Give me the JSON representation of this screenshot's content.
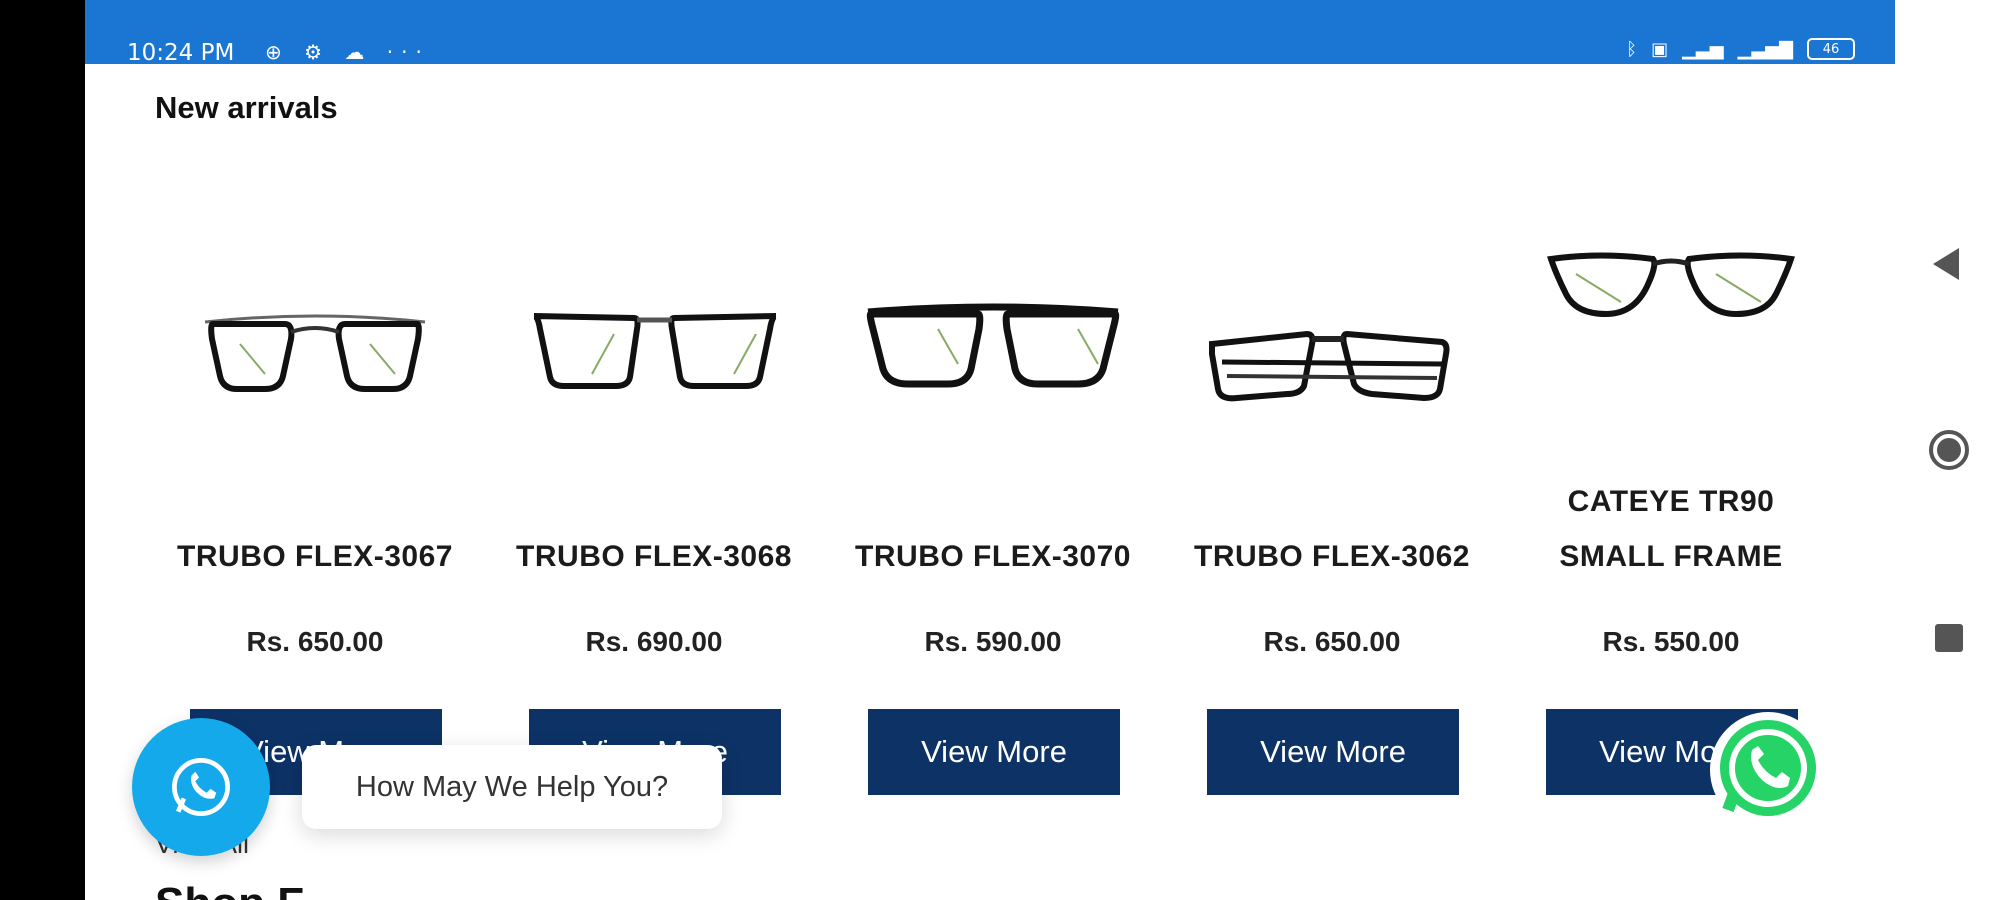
{
  "status_bar": {
    "time": "10:24 PM",
    "left_icons": "⊕ ⚙ ☁ ···",
    "right_icons": [
      "bluetooth-icon",
      "nfc-icon",
      "signal-4g-icon",
      "signal-icon"
    ],
    "battery_level": "46"
  },
  "section": {
    "title": "New arrivals",
    "view_all": "View All",
    "next_heading": "Shop F",
    "next_side": "..."
  },
  "products": [
    {
      "name": "TRUBO FLEX-3067",
      "price": "Rs. 650.00",
      "button": "View More",
      "image_icon": "eyeglasses-round-icon"
    },
    {
      "name": "TRUBO FLEX-3068",
      "price": "Rs. 690.00",
      "button": "View More",
      "image_icon": "eyeglasses-rectangle-icon"
    },
    {
      "name": "TRUBO FLEX-3070",
      "price": "Rs. 590.00",
      "button": "View More",
      "image_icon": "eyeglasses-square-icon"
    },
    {
      "name": "TRUBO FLEX-3062",
      "price": "Rs. 650.00",
      "button": "View More",
      "image_icon": "eyeglasses-folded-icon"
    },
    {
      "name_line1": "CATEYE TR90",
      "name_line2": "SMALL FRAME",
      "price": "Rs. 550.00",
      "button": "View More",
      "image_icon": "eyeglasses-cateye-icon"
    }
  ],
  "chat": {
    "help_text": "How May We Help You?",
    "bubble_icon": "whatsapp-icon",
    "bubble_color": "#14a9ea",
    "wa_color": "#25d366"
  },
  "colors": {
    "status_bar": "#1a76d2",
    "button": "#0d3266"
  }
}
